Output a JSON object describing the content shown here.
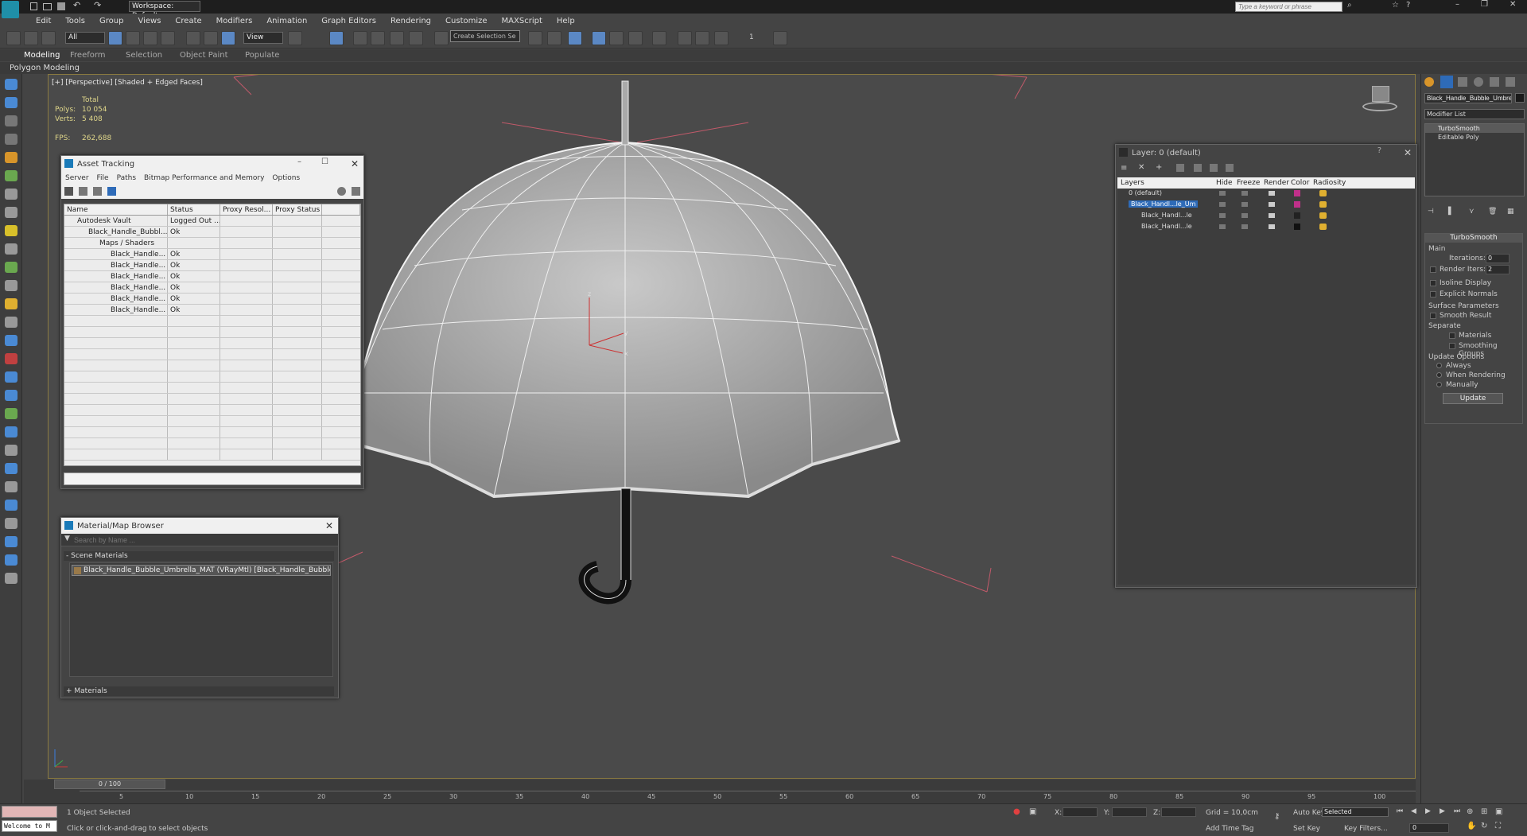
{
  "title_bar": {
    "workspace_label": "Workspace: Default",
    "search_placeholder": "Type a keyword or phrase"
  },
  "menu": [
    "Edit",
    "Tools",
    "Group",
    "Views",
    "Create",
    "Modifiers",
    "Animation",
    "Graph Editors",
    "Rendering",
    "Customize",
    "MAXScript",
    "Help"
  ],
  "toolbar": {
    "filter_value": "All",
    "view_value": "View",
    "selection_set_placeholder": "Create Selection Se",
    "spinner_value": "1"
  },
  "ribbon": {
    "tabs": [
      "Modeling",
      "Freeform",
      "Selection",
      "Object Paint",
      "Populate"
    ],
    "sub_label": "Polygon Modeling"
  },
  "viewport": {
    "label": "[+] [Perspective] [Shaded + Edged Faces]",
    "stats": {
      "total_label": "Total",
      "polys_label": "Polys:",
      "polys_value": "10 054",
      "verts_label": "Verts:",
      "verts_value": "5 408",
      "fps_label": "FPS:",
      "fps_value": "262,688"
    },
    "axis_labels": {
      "z": "z",
      "y": "y",
      "x": "x"
    }
  },
  "asset_tracking": {
    "title": "Asset Tracking",
    "menu": [
      "Server",
      "File",
      "Paths",
      "Bitmap Performance and Memory",
      "Options"
    ],
    "columns": [
      "Name",
      "Status",
      "Proxy Resol...",
      "Proxy Status"
    ],
    "rows": [
      {
        "name": "Autodesk Vault",
        "status": "Logged Out ..."
      },
      {
        "name": "Black_Handle_Bubbl...",
        "status": "Ok"
      },
      {
        "name": "Maps / Shaders",
        "status": ""
      },
      {
        "name": "Black_Handle...",
        "status": "Ok"
      },
      {
        "name": "Black_Handle...",
        "status": "Ok"
      },
      {
        "name": "Black_Handle...",
        "status": "Ok"
      },
      {
        "name": "Black_Handle...",
        "status": "Ok"
      },
      {
        "name": "Black_Handle...",
        "status": "Ok"
      },
      {
        "name": "Black_Handle...",
        "status": "Ok"
      }
    ]
  },
  "material_browser": {
    "title": "Material/Map Browser",
    "search_placeholder": "Search by Name ...",
    "scene_materials_label": "- Scene Materials",
    "material_item": "Black_Handle_Bubble_Umbrella_MAT (VRayMtl) [Black_Handle_Bubble_Umb...",
    "materials_label": "+ Materials"
  },
  "layer_window": {
    "title": "Layer: 0 (default)",
    "columns": [
      "Layers",
      "Hide",
      "Freeze",
      "Render",
      "Color",
      "Radiosity"
    ],
    "rows": [
      {
        "name": "0 (default)",
        "color": "#c0308a",
        "selected": false
      },
      {
        "name": "Black_Handl...le_Um",
        "color": "#c0308a",
        "selected": true
      },
      {
        "name": "Black_Handl...le",
        "color": "#222222",
        "selected": false
      },
      {
        "name": "Black_Handl...le",
        "color": "#111111",
        "selected": false
      }
    ]
  },
  "command_panel": {
    "object_name": "Black_Handle_Bubble_Umbrel",
    "modifier_list": "Modifier List",
    "stack": [
      "TurboSmooth",
      "Editable Poly"
    ],
    "rollout_title": "TurboSmooth",
    "main_label": "Main",
    "iterations_label": "Iterations:",
    "iterations_value": "0",
    "render_iters_label": "Render Iters:",
    "render_iters_value": "2",
    "isoline_label": "Isoline Display",
    "explicit_normals_label": "Explicit Normals",
    "surface_params_label": "Surface Parameters",
    "smooth_result_label": "Smooth Result",
    "separate_label": "Separate",
    "materials_label": "Materials",
    "smoothing_groups_label": "Smoothing Groups",
    "update_options_label": "Update Options",
    "always_label": "Always",
    "when_rendering_label": "When Rendering",
    "manually_label": "Manually",
    "update_button": "Update"
  },
  "timeline": {
    "frame_counter": "0 / 100",
    "ticks": [
      "5",
      "10",
      "15",
      "20",
      "25",
      "30",
      "35",
      "40",
      "45",
      "50",
      "55",
      "60",
      "65",
      "70",
      "75",
      "80",
      "85",
      "90",
      "95",
      "100"
    ]
  },
  "status_bar": {
    "maxscript_text": "Welcome to M",
    "selection_text": "1 Object Selected",
    "prompt_text": "Click or click-and-drag to select objects",
    "x_label": "X:",
    "y_label": "Y:",
    "z_label": "Z:",
    "grid_text": "Grid = 10,0cm",
    "add_time_tag": "Add Time Tag",
    "auto_key": "Auto Key",
    "selected_value": "Selected",
    "set_key": "Set Key",
    "key_filters": "Key Filters...",
    "frame_value": "0"
  }
}
